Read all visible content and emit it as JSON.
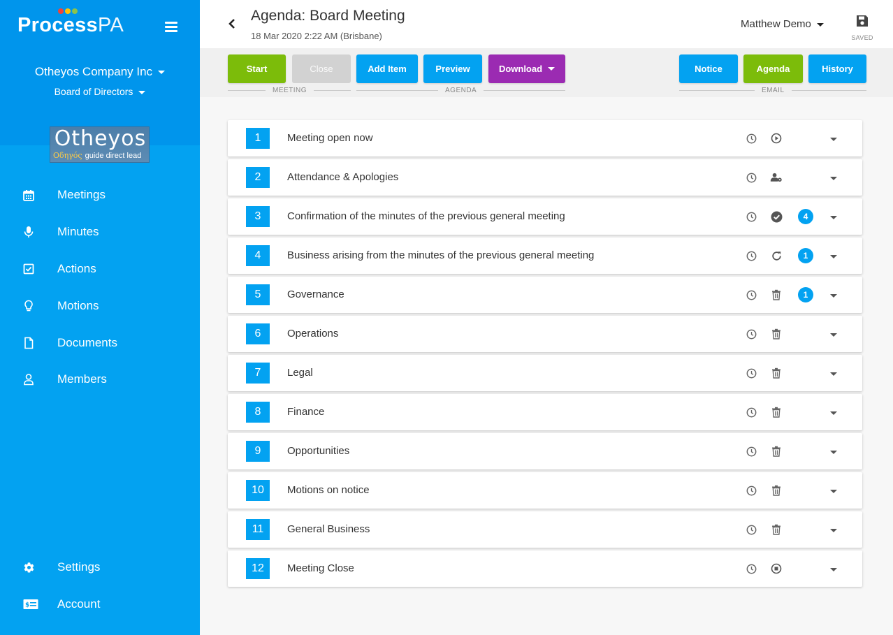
{
  "brand": {
    "name_bold": "Process",
    "name_light": "PA",
    "dot_colors": [
      "#f44336",
      "#ffc107",
      "#8bc34a"
    ]
  },
  "org": {
    "company": "Otheyos Company Inc",
    "board": "Board of Directors"
  },
  "logo": {
    "main": "Otheyos",
    "greek": "Οδηγός",
    "tagline": "guide direct lead"
  },
  "nav": {
    "items": [
      {
        "label": "Meetings",
        "icon": "calendar-icon"
      },
      {
        "label": "Minutes",
        "icon": "microphone-icon"
      },
      {
        "label": "Actions",
        "icon": "checkbox-icon"
      },
      {
        "label": "Motions",
        "icon": "lightbulb-icon"
      },
      {
        "label": "Documents",
        "icon": "document-icon"
      },
      {
        "label": "Members",
        "icon": "person-icon"
      }
    ],
    "settings": "Settings",
    "account": "Account"
  },
  "header": {
    "title": "Agenda: Board Meeting",
    "subtitle": "18 Mar 2020 2:22 AM (Brisbane)",
    "user": "Matthew Demo",
    "save_label": "SAVED"
  },
  "toolbar": {
    "start": "Start",
    "close": "Close",
    "add_item": "Add Item",
    "preview": "Preview",
    "download": "Download",
    "notice": "Notice",
    "agenda": "Agenda",
    "history": "History",
    "groups": {
      "meeting": "MEETING",
      "agenda": "AGENDA",
      "email": "EMAIL"
    }
  },
  "colors": {
    "primary": "#03a2f1",
    "sidebar_top": "#0095ec",
    "green": "#7cbc0a",
    "purple": "#9b2bb2",
    "disabled": "#d2d2d2"
  },
  "agenda": [
    {
      "num": "1",
      "title": "Meeting open now",
      "action_icon": "play-icon",
      "count": ""
    },
    {
      "num": "2",
      "title": "Attendance & Apologies",
      "action_icon": "person-settings-icon",
      "count": ""
    },
    {
      "num": "3",
      "title": "Confirmation of the minutes of the previous general meeting",
      "action_icon": "check-circle-icon",
      "count": "4"
    },
    {
      "num": "4",
      "title": "Business arising from the minutes of the previous general meeting",
      "action_icon": "refresh-icon",
      "count": "1"
    },
    {
      "num": "5",
      "title": "Governance",
      "action_icon": "trash-icon",
      "count": "1"
    },
    {
      "num": "6",
      "title": "Operations",
      "action_icon": "trash-icon",
      "count": ""
    },
    {
      "num": "7",
      "title": "Legal",
      "action_icon": "trash-icon",
      "count": ""
    },
    {
      "num": "8",
      "title": "Finance",
      "action_icon": "trash-icon",
      "count": ""
    },
    {
      "num": "9",
      "title": "Opportunities",
      "action_icon": "trash-icon",
      "count": ""
    },
    {
      "num": "10",
      "title": "Motions on notice",
      "action_icon": "trash-icon",
      "count": ""
    },
    {
      "num": "11",
      "title": "General Business",
      "action_icon": "trash-icon",
      "count": ""
    },
    {
      "num": "12",
      "title": "Meeting Close",
      "action_icon": "stop-icon",
      "count": ""
    }
  ]
}
